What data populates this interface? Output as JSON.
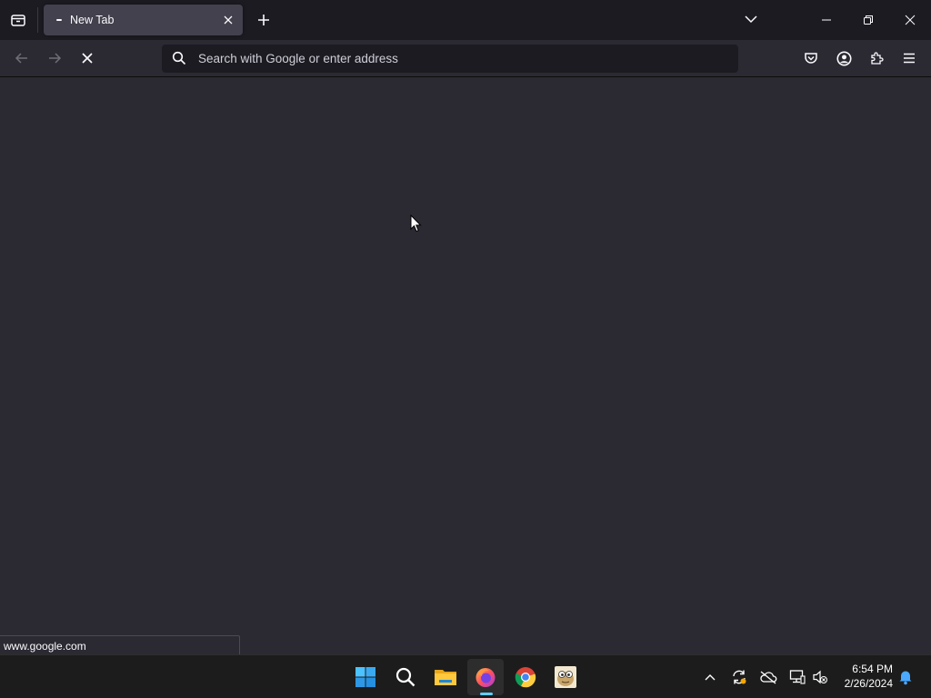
{
  "browser": {
    "tab": {
      "title": "New Tab"
    },
    "urlbar": {
      "placeholder": "Search with Google or enter address",
      "value": ""
    },
    "status_text": "www.google.com"
  },
  "taskbar": {
    "apps": [
      "windows-start",
      "search",
      "file-explorer",
      "firefox",
      "chrome",
      "app-6"
    ],
    "active_app": "firefox",
    "clock": {
      "time": "6:54 PM",
      "date": "2/26/2024"
    }
  },
  "colors": {
    "tabstrip": "#1c1b22",
    "toolbar": "#2b2a33",
    "selected_tab": "#42414d",
    "taskbar": "#1c1c1c",
    "accent": "#60cdff"
  }
}
